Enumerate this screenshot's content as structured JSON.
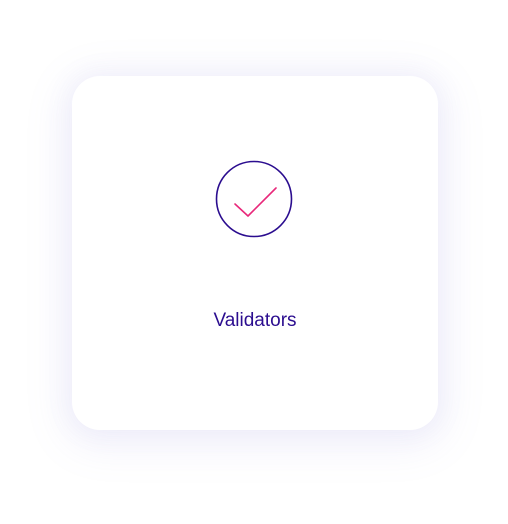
{
  "card": {
    "label": "Validators",
    "icon": "checkmark-circle-icon"
  },
  "colors": {
    "label": "#2b0d8f",
    "circle": "#2b0d8f",
    "check": "#e8287a"
  }
}
